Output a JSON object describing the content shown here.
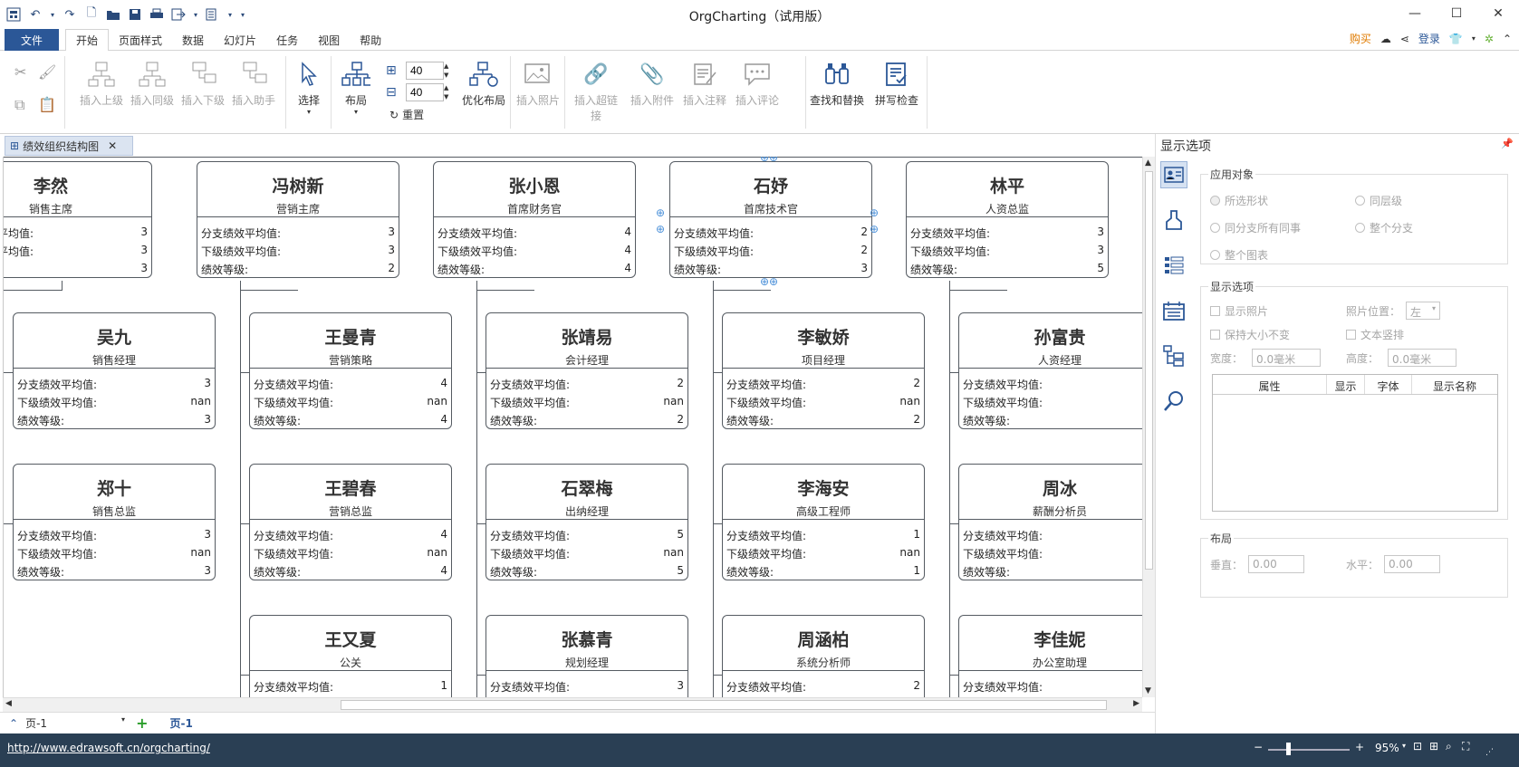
{
  "app": {
    "title": "OrgCharting（试用版）"
  },
  "menu": {
    "file": "文件",
    "tabs": [
      "开始",
      "页面样式",
      "数据",
      "幻灯片",
      "任务",
      "视图",
      "帮助"
    ],
    "buy": "购买",
    "login": "登录"
  },
  "ribbon": {
    "insert_parent": "插入上级",
    "insert_sibling": "插入同级",
    "insert_child": "插入下级",
    "insert_assistant": "插入助手",
    "select": "选择",
    "layout": "布局",
    "spacing_h": "40",
    "spacing_v": "40",
    "reset": "重置",
    "optimize": "优化布局",
    "insert_photo": "插入照片",
    "insert_link": "插入超链接",
    "insert_attachment": "插入附件",
    "insert_note": "插入注释",
    "insert_comment": "插入评论",
    "find_replace": "查找和替换",
    "spell_check": "拼写检查"
  },
  "doc_tab": "绩效组织结构图",
  "labels": {
    "branch": "分支绩效平均值:",
    "sub": "下级绩效平均值:",
    "grade": "绩效等级:"
  },
  "nodes": [
    {
      "name": "李然",
      "title": "销售主席",
      "branch": "3",
      "sub": "3",
      "grade": "3"
    },
    {
      "name": "冯树新",
      "title": "营销主席",
      "branch": "3",
      "sub": "3",
      "grade": "2"
    },
    {
      "name": "张小恩",
      "title": "首席财务官",
      "branch": "4",
      "sub": "4",
      "grade": "4"
    },
    {
      "name": "石妤",
      "title": "首席技术官",
      "branch": "2",
      "sub": "2",
      "grade": "3"
    },
    {
      "name": "林平",
      "title": "人资总监",
      "branch": "3",
      "sub": "3",
      "grade": "5"
    },
    {
      "name": "吴九",
      "title": "销售经理",
      "branch": "3",
      "sub": "nan",
      "grade": "3"
    },
    {
      "name": "王曼青",
      "title": "营销策略",
      "branch": "4",
      "sub": "nan",
      "grade": "4"
    },
    {
      "name": "张靖易",
      "title": "会计经理",
      "branch": "2",
      "sub": "nan",
      "grade": "2"
    },
    {
      "name": "李敏娇",
      "title": "项目经理",
      "branch": "2",
      "sub": "nan",
      "grade": "2"
    },
    {
      "name": "孙富贵",
      "title": "人资经理",
      "branch": "",
      "sub": "",
      "grade": ""
    },
    {
      "name": "郑十",
      "title": "销售总监",
      "branch": "3",
      "sub": "nan",
      "grade": "3"
    },
    {
      "name": "王碧春",
      "title": "营销总监",
      "branch": "4",
      "sub": "nan",
      "grade": "4"
    },
    {
      "name": "石翠梅",
      "title": "出纳经理",
      "branch": "5",
      "sub": "nan",
      "grade": "5"
    },
    {
      "name": "李海安",
      "title": "高级工程师",
      "branch": "1",
      "sub": "nan",
      "grade": "1"
    },
    {
      "name": "周冰",
      "title": "薪酬分析员",
      "branch": "",
      "sub": "",
      "grade": ""
    },
    {
      "name": "王又夏",
      "title": "公关",
      "branch": "1",
      "sub": "",
      "grade": ""
    },
    {
      "name": "张慕青",
      "title": "规划经理",
      "branch": "3",
      "sub": "",
      "grade": ""
    },
    {
      "name": "周涵柏",
      "title": "系统分析师",
      "branch": "2",
      "sub": "",
      "grade": ""
    },
    {
      "name": "李佳妮",
      "title": "办公室助理",
      "branch": "",
      "sub": "",
      "grade": ""
    }
  ],
  "pages": {
    "selector": "页-1",
    "active": "页-1"
  },
  "status": {
    "url": "http://www.edrawsoft.cn/orgcharting/",
    "zoom": "95%"
  },
  "panel": {
    "title": "显示选项",
    "apply_to": "应用对象",
    "r1": "所选形状",
    "r2": "同层级",
    "r3": "同分支所有同事",
    "r4": "整个分支",
    "r5": "整个图表",
    "display_opts": "显示选项",
    "show_photo": "显示照片",
    "photo_pos": "照片位置：",
    "photo_pos_val": "左",
    "keep_size": "保持大小不变",
    "vertical_text": "文本竖排",
    "width": "宽度：",
    "width_val": "0.0毫米",
    "height": "高度：",
    "height_val": "0.0毫米",
    "cols": [
      "属性",
      "显示",
      "字体",
      "显示名称"
    ],
    "layout": "布局",
    "vert": "垂直：",
    "vert_val": "0.00",
    "horz": "水平：",
    "horz_val": "0.00"
  }
}
